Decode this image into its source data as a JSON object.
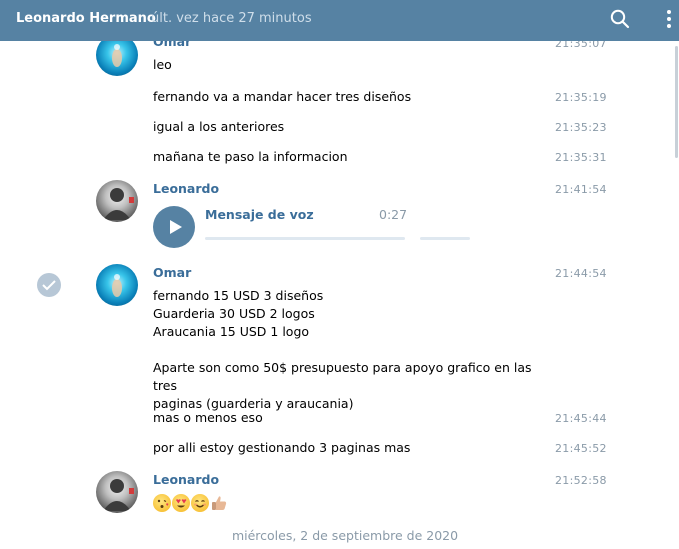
{
  "header": {
    "contact_name": "Leonardo Hermano",
    "status": "últ. vez hace 27 minutos"
  },
  "icons": {
    "search": "search-icon",
    "menu": "more-vertical-icon",
    "play": "play-icon",
    "check": "check-icon"
  },
  "colors": {
    "header_bg": "#5682a3",
    "sender_name": "#3a6d99",
    "timestamp": "#8a9aa8"
  },
  "messages": {
    "g1": {
      "sender": "Omar",
      "first_time": "21:35:07",
      "items": [
        {
          "text": "leo"
        },
        {
          "text": "fernando va a mandar hacer tres diseños",
          "time": "21:35:19"
        },
        {
          "text": "igual a los anteriores",
          "time": "21:35:23"
        },
        {
          "text": "mañana te paso la informacion",
          "time": "21:35:31"
        }
      ]
    },
    "g2": {
      "sender": "Leonardo",
      "time": "21:41:54",
      "voice": {
        "title": "Mensaje de voz",
        "duration": "0:27"
      }
    },
    "g3": {
      "sender": "Omar",
      "time": "21:44:54",
      "body": "fernando 15 USD 3 diseños\nGuarderia 30 USD 2 logos\nAraucania 15 USD 1 logo\n\nAparte son como 50$ presupuesto para apoyo grafico en las tres\npaginas (guarderia y araucania)",
      "items": [
        {
          "text": "mas o menos eso",
          "time": "21:45:44"
        },
        {
          "text": "por alli estoy gestionando 3 paginas mas",
          "time": "21:45:52"
        }
      ]
    },
    "g4": {
      "sender": "Leonardo",
      "time": "21:52:58",
      "emojis": [
        "kissing-face-emoji",
        "heart-eyes-emoji",
        "smiling-face-emoji",
        "thumbs-up-emoji"
      ]
    }
  },
  "date_divider": "miércoles, 2 de septiembre de 2020"
}
